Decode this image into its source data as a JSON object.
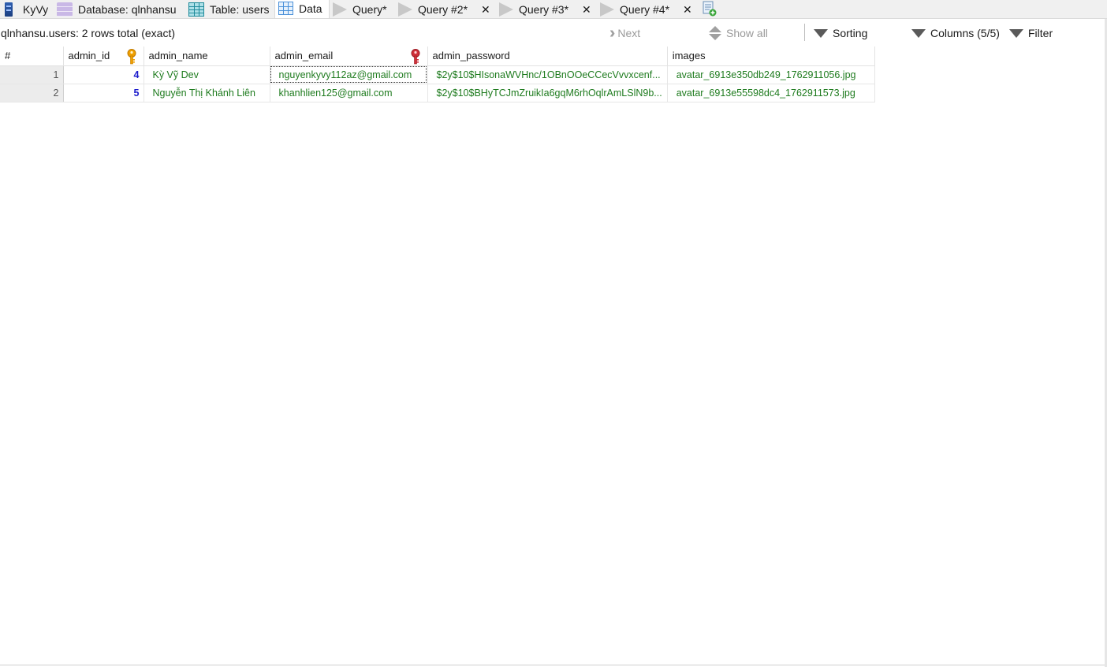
{
  "tabs": [
    {
      "label": "KyVy",
      "icon": "server-icon"
    },
    {
      "label": "Database: qlnhansu",
      "icon": "database-icon"
    },
    {
      "label": "Table: users",
      "icon": "table-icon"
    },
    {
      "label": "Data",
      "icon": "grid-icon",
      "active": true
    },
    {
      "label": "Query*",
      "icon": "play-icon"
    },
    {
      "label": "Query #2*",
      "icon": "play-icon",
      "close": "✕"
    },
    {
      "label": "Query #3*",
      "icon": "play-icon",
      "close": "✕"
    },
    {
      "label": "Query #4*",
      "icon": "play-icon",
      "close": "✕"
    }
  ],
  "toolbar": {
    "info": "qlnhansu.users: 2 rows total (exact)",
    "next": "Next",
    "show_all": "Show all",
    "sorting": "Sorting",
    "columns": "Columns (5/5)",
    "filter": "Filter"
  },
  "grid": {
    "headers": [
      "#",
      "admin_id",
      "admin_name",
      "admin_email",
      "admin_password",
      "images"
    ],
    "rows": [
      {
        "num": "1",
        "admin_id": "4",
        "admin_name": "Kỳ Vỹ Dev",
        "admin_email": "nguyenkyvy112az@gmail.com",
        "admin_password": "$2y$10$HIsonaWVHnc/1OBnOOeCCecVvvxcenf...",
        "images": "avatar_6913e350db249_1762911056.jpg"
      },
      {
        "num": "2",
        "admin_id": "5",
        "admin_name": "Nguyễn Thị Khánh Liên",
        "admin_email": "khanhlien125@gmail.com",
        "admin_password": "$2y$10$BHyTCJmZruikIa6gqM6rhOqlrAmLSlN9b...",
        "images": "avatar_6913e55598dc4_1762911573.jpg"
      }
    ]
  },
  "colors": {
    "value_text": "#1e7b1e",
    "id_text": "#1a1acc",
    "primary_key": "#f0a000",
    "foreign_key": "#d0303a"
  }
}
